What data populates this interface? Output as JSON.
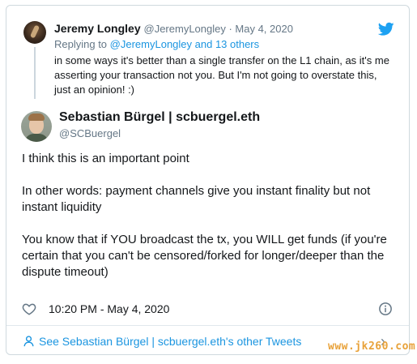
{
  "reply": {
    "author_name": "Jeremy Longley",
    "author_meta": "@JeremyLongley · May 4, 2020",
    "replying_prefix": "Replying to",
    "replying_to": "@JeremyLongley and 13 others",
    "text": "in some ways it's better than a single transfer on the L1 chain, as it's me asserting your transaction not you.  But I'm not going to overstate this, just an opinion! :)"
  },
  "tweet": {
    "author_name": "Sebastian Bürgel | scbuergel.eth",
    "author_handle": "@SCBuergel",
    "paragraphs": [
      "I think this is an important point",
      "In other words: payment channels give you instant finality but not instant liquidity",
      "You know that if YOU broadcast the tx, you WILL get funds (if you're certain that you can't be censored/forked for longer/deeper than the dispute timeout)"
    ],
    "timestamp": "10:20 PM - May 4, 2020"
  },
  "footer": {
    "see_more": "See Sebastian Bürgel | scbuergel.eth's other Tweets"
  },
  "watermark": "www.jk260.com",
  "colors": {
    "link": "#1b95e0",
    "muted": "#657786",
    "text": "#14171a",
    "twitter_blue": "#1da1f2"
  },
  "icons": [
    "twitter-bird-icon",
    "heart-icon",
    "info-icon",
    "person-icon",
    "chevron-right-icon"
  ]
}
